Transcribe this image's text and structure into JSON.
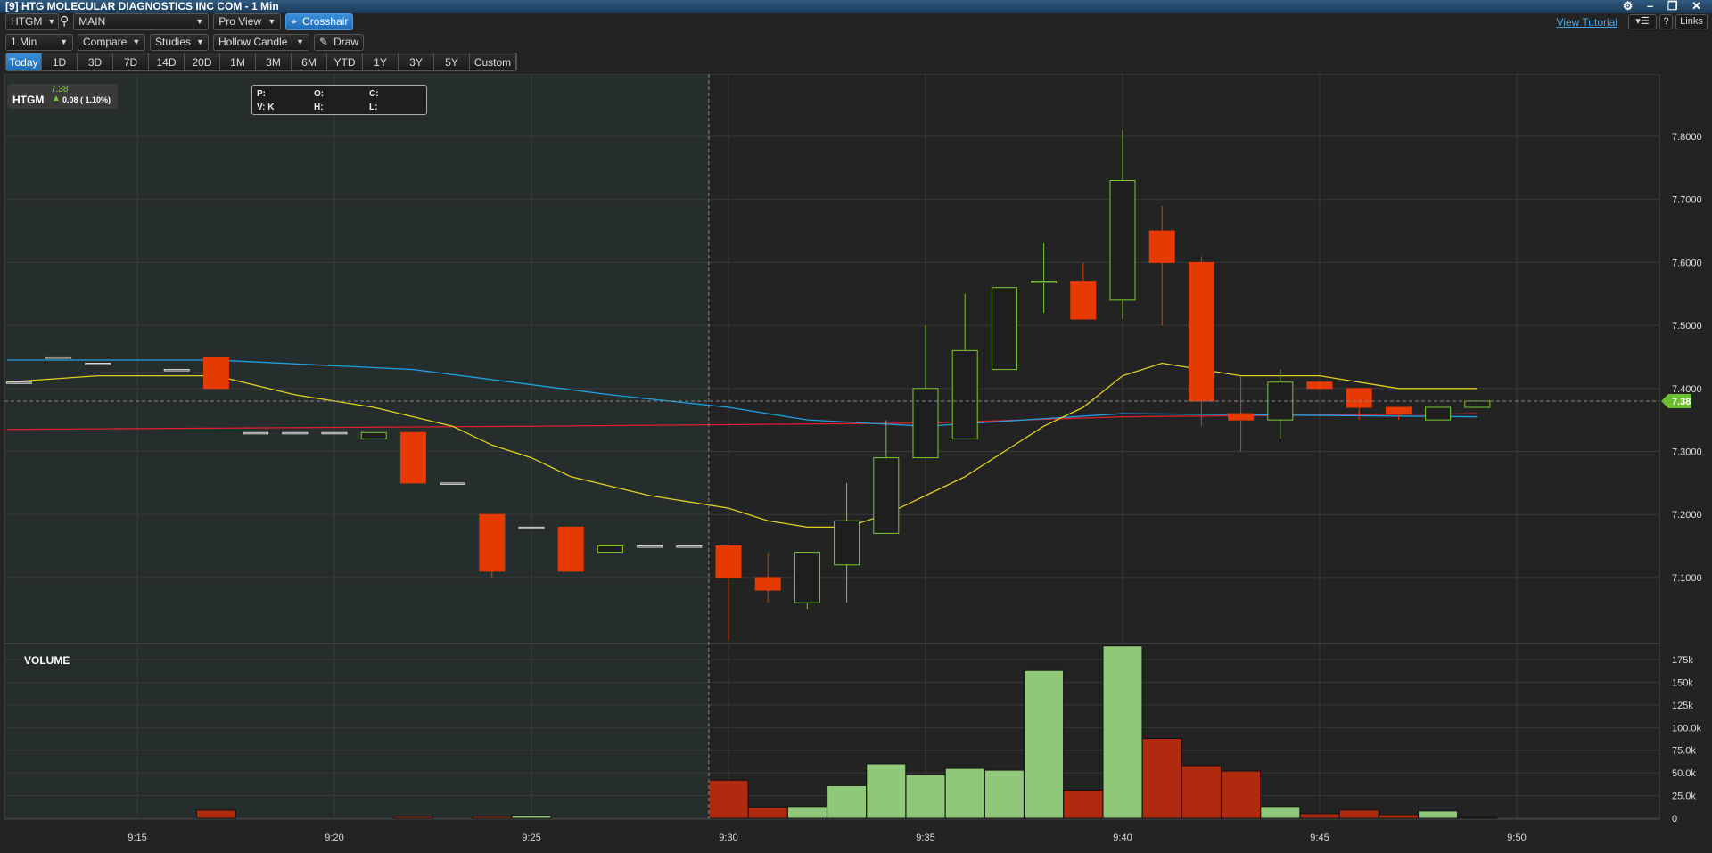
{
  "window": {
    "title": "[9] HTG MOLECULAR DIAGNOSTICS INC COM - 1 Min",
    "controls": "⚙ – ❐ ✕"
  },
  "toolbar": {
    "symbol": "HTGM",
    "layout": "MAIN",
    "view": "Pro View",
    "crosshair": "Crosshair",
    "interval": "1 Min",
    "compare": "Compare",
    "studies": "Studies",
    "chart_type": "Hollow Candle",
    "draw": "Draw",
    "view_tutorial": "View Tutorial",
    "help": "?",
    "links": "Links"
  },
  "ranges": [
    "Today",
    "1D",
    "3D",
    "7D",
    "14D",
    "20D",
    "1M",
    "3M",
    "6M",
    "YTD",
    "1Y",
    "3Y",
    "5Y",
    "Custom"
  ],
  "active_range": "Today",
  "quote": {
    "symbol": "HTGM",
    "last": "7.38",
    "change": "0.08 ( 1.10%)"
  },
  "info": {
    "p": "P:",
    "o": "O:",
    "c": "C:",
    "v": "V: K",
    "h": "H:",
    "l": "L:"
  },
  "volume_label": "VOLUME",
  "last_price_tag": "7.38",
  "colors": {
    "up": "#7dc832",
    "down": "#e63a00",
    "vol_up": "#8fc878",
    "vol_down": "#b02a10",
    "ma1": "#e0d020",
    "ma2": "#20a0e0",
    "ma3": "#e02030",
    "accent": "#2a82d0"
  },
  "chart_data": {
    "type": "candlestick",
    "price_ticks": [
      "7.1000",
      "7.2000",
      "7.3000",
      "7.4000",
      "7.5000",
      "7.6000",
      "7.7000",
      "7.8000"
    ],
    "volume_ticks": [
      "0",
      "25.0k",
      "50.0k",
      "75.0k",
      "100.0k",
      "125k",
      "150k",
      "175k"
    ],
    "time_ticks": [
      "9:15",
      "9:20",
      "9:25",
      "9:30",
      "9:35",
      "9:40",
      "9:45",
      "9:50"
    ],
    "crosshair_price": 7.38,
    "candles": [
      {
        "t": 12,
        "o": 7.41,
        "h": 7.41,
        "l": 7.41,
        "c": 7.41
      },
      {
        "t": 13,
        "o": 7.45,
        "h": 7.45,
        "l": 7.45,
        "c": 7.45
      },
      {
        "t": 14,
        "o": 7.44,
        "h": 7.44,
        "l": 7.44,
        "c": 7.44
      },
      {
        "t": 16,
        "o": 7.43,
        "h": 7.43,
        "l": 7.43,
        "c": 7.43
      },
      {
        "t": 17,
        "o": 7.45,
        "h": 7.45,
        "l": 7.4,
        "c": 7.4
      },
      {
        "t": 18,
        "o": 7.33,
        "h": 7.33,
        "l": 7.33,
        "c": 7.33
      },
      {
        "t": 19,
        "o": 7.33,
        "h": 7.33,
        "l": 7.33,
        "c": 7.33
      },
      {
        "t": 20,
        "o": 7.33,
        "h": 7.33,
        "l": 7.33,
        "c": 7.33
      },
      {
        "t": 21,
        "o": 7.32,
        "h": 7.33,
        "l": 7.32,
        "c": 7.33
      },
      {
        "t": 22,
        "o": 7.33,
        "h": 7.33,
        "l": 7.25,
        "c": 7.25
      },
      {
        "t": 23,
        "o": 7.25,
        "h": 7.25,
        "l": 7.25,
        "c": 7.25
      },
      {
        "t": 24,
        "o": 7.2,
        "h": 7.2,
        "l": 7.1,
        "c": 7.11
      },
      {
        "t": 25,
        "o": 7.18,
        "h": 7.18,
        "l": 7.18,
        "c": 7.18
      },
      {
        "t": 26,
        "o": 7.18,
        "h": 7.18,
        "l": 7.11,
        "c": 7.11
      },
      {
        "t": 27,
        "o": 7.14,
        "h": 7.15,
        "l": 7.14,
        "c": 7.15
      },
      {
        "t": 28,
        "o": 7.15,
        "h": 7.15,
        "l": 7.15,
        "c": 7.15
      },
      {
        "t": 29,
        "o": 7.15,
        "h": 7.15,
        "l": 7.15,
        "c": 7.15
      },
      {
        "t": 30,
        "o": 7.15,
        "h": 7.15,
        "l": 7.0,
        "c": 7.1
      },
      {
        "t": 31,
        "o": 7.1,
        "h": 7.14,
        "l": 7.06,
        "c": 7.08
      },
      {
        "t": 32,
        "o": 7.06,
        "h": 7.14,
        "l": 7.05,
        "c": 7.14
      },
      {
        "t": 33,
        "o": 7.12,
        "h": 7.25,
        "l": 7.06,
        "c": 7.19
      },
      {
        "t": 34,
        "o": 7.17,
        "h": 7.35,
        "l": 7.17,
        "c": 7.29
      },
      {
        "t": 35,
        "o": 7.29,
        "h": 7.5,
        "l": 7.29,
        "c": 7.4
      },
      {
        "t": 36,
        "o": 7.32,
        "h": 7.55,
        "l": 7.32,
        "c": 7.46
      },
      {
        "t": 37,
        "o": 7.43,
        "h": 7.56,
        "l": 7.43,
        "c": 7.56
      },
      {
        "t": 38,
        "o": 7.57,
        "h": 7.63,
        "l": 7.52,
        "c": 7.57
      },
      {
        "t": 39,
        "o": 7.57,
        "h": 7.6,
        "l": 7.51,
        "c": 7.51
      },
      {
        "t": 40,
        "o": 7.54,
        "h": 7.81,
        "l": 7.51,
        "c": 7.73
      },
      {
        "t": 41,
        "o": 7.65,
        "h": 7.69,
        "l": 7.5,
        "c": 7.6
      },
      {
        "t": 42,
        "o": 7.6,
        "h": 7.61,
        "l": 7.34,
        "c": 7.38
      },
      {
        "t": 43,
        "o": 7.36,
        "h": 7.42,
        "l": 7.3,
        "c": 7.35
      },
      {
        "t": 44,
        "o": 7.35,
        "h": 7.43,
        "l": 7.32,
        "c": 7.41
      },
      {
        "t": 45,
        "o": 7.41,
        "h": 7.41,
        "l": 7.4,
        "c": 7.4
      },
      {
        "t": 46,
        "o": 7.4,
        "h": 7.4,
        "l": 7.35,
        "c": 7.37
      },
      {
        "t": 47,
        "o": 7.37,
        "h": 7.37,
        "l": 7.35,
        "c": 7.36
      },
      {
        "t": 48,
        "o": 7.35,
        "h": 7.37,
        "l": 7.35,
        "c": 7.37
      },
      {
        "t": 49,
        "o": 7.37,
        "h": 7.38,
        "l": 7.37,
        "c": 7.38
      }
    ],
    "volume": [
      [
        17,
        9,
        0
      ],
      [
        22,
        2,
        0
      ],
      [
        24,
        2,
        0
      ],
      [
        25,
        3,
        1
      ],
      [
        30,
        42,
        0
      ],
      [
        31,
        12,
        0
      ],
      [
        32,
        13,
        1
      ],
      [
        33,
        36,
        1
      ],
      [
        34,
        60,
        1
      ],
      [
        35,
        48,
        1
      ],
      [
        36,
        55,
        1
      ],
      [
        37,
        53,
        1
      ],
      [
        38,
        163,
        1
      ],
      [
        39,
        31,
        0
      ],
      [
        40,
        190,
        1
      ],
      [
        41,
        88,
        0
      ],
      [
        42,
        58,
        0
      ],
      [
        43,
        52,
        0
      ],
      [
        44,
        13,
        1
      ],
      [
        45,
        5,
        0
      ],
      [
        46,
        9,
        0
      ],
      [
        47,
        4,
        0
      ],
      [
        48,
        8,
        1
      ],
      [
        49,
        1,
        1
      ]
    ],
    "ma_yellow": [
      [
        11.7,
        7.41
      ],
      [
        14,
        7.42
      ],
      [
        17,
        7.42
      ],
      [
        19,
        7.39
      ],
      [
        21,
        7.37
      ],
      [
        23,
        7.34
      ],
      [
        24,
        7.31
      ],
      [
        25,
        7.29
      ],
      [
        26,
        7.26
      ],
      [
        28,
        7.23
      ],
      [
        29,
        7.22
      ],
      [
        30,
        7.21
      ],
      [
        31,
        7.19
      ],
      [
        32,
        7.18
      ],
      [
        33,
        7.18
      ],
      [
        34,
        7.2
      ],
      [
        35,
        7.23
      ],
      [
        36,
        7.26
      ],
      [
        37,
        7.3
      ],
      [
        38,
        7.34
      ],
      [
        39,
        7.37
      ],
      [
        40,
        7.42
      ],
      [
        41,
        7.44
      ],
      [
        42,
        7.43
      ],
      [
        43,
        7.42
      ],
      [
        45,
        7.42
      ],
      [
        47,
        7.4
      ],
      [
        49,
        7.4
      ]
    ],
    "ma_blue": [
      [
        11.7,
        7.445
      ],
      [
        17,
        7.445
      ],
      [
        22,
        7.43
      ],
      [
        27,
        7.39
      ],
      [
        30,
        7.37
      ],
      [
        32,
        7.35
      ],
      [
        35,
        7.34
      ],
      [
        40,
        7.36
      ],
      [
        49,
        7.355
      ]
    ],
    "ma_red": [
      [
        11.7,
        7.335
      ],
      [
        25,
        7.34
      ],
      [
        35,
        7.345
      ],
      [
        40,
        7.355
      ],
      [
        49,
        7.36
      ]
    ]
  }
}
